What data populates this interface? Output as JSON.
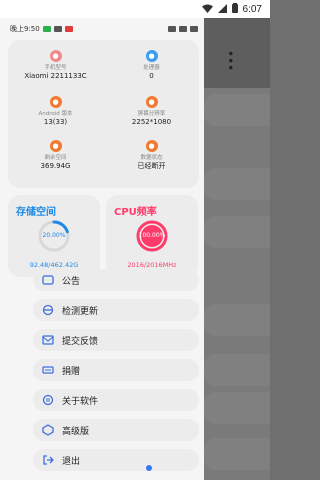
{
  "system_status": {
    "time": "6:07"
  },
  "drawer_status": {
    "left_text": "晚上9:50"
  },
  "device_info": [
    {
      "label": "手机型号",
      "value": "Xiaomi 2211133C",
      "icon": "phone-icon",
      "color": "#f08a8a"
    },
    {
      "label": "处理器",
      "value": "0",
      "icon": "cpu-icon",
      "color": "#3a9ef0"
    },
    {
      "label": "Android 版本",
      "value": "13(33)",
      "icon": "android-icon",
      "color": "#f07a30"
    },
    {
      "label": "屏幕分辨率",
      "value": "2252*1080",
      "icon": "screen-icon",
      "color": "#f07a30"
    },
    {
      "label": "剩余空间",
      "value": "369.94G",
      "icon": "storage-icon",
      "color": "#f07a30"
    },
    {
      "label": "数据状态",
      "value": "已经断开",
      "icon": "data-icon",
      "color": "#f07a30"
    }
  ],
  "storage": {
    "title": "存储空间",
    "percent_label": "20.00%",
    "percent": 0.2,
    "detail": "92.48/462.42G",
    "color": "#1e88e5"
  },
  "cpu": {
    "title": "CPU频率",
    "percent_label": "100.00%",
    "percent": 1.0,
    "detail": "2016/2016MHz",
    "color": "#ff3b6b"
  },
  "menu": [
    {
      "label": "公告",
      "icon": "notice-icon"
    },
    {
      "label": "检测更新",
      "icon": "update-icon"
    },
    {
      "label": "提交反馈",
      "icon": "feedback-icon"
    },
    {
      "label": "捐赠",
      "icon": "donate-icon"
    },
    {
      "label": "关于软件",
      "icon": "info-icon"
    },
    {
      "label": "高级版",
      "icon": "premium-icon"
    },
    {
      "label": "退出",
      "icon": "exit-icon"
    }
  ]
}
